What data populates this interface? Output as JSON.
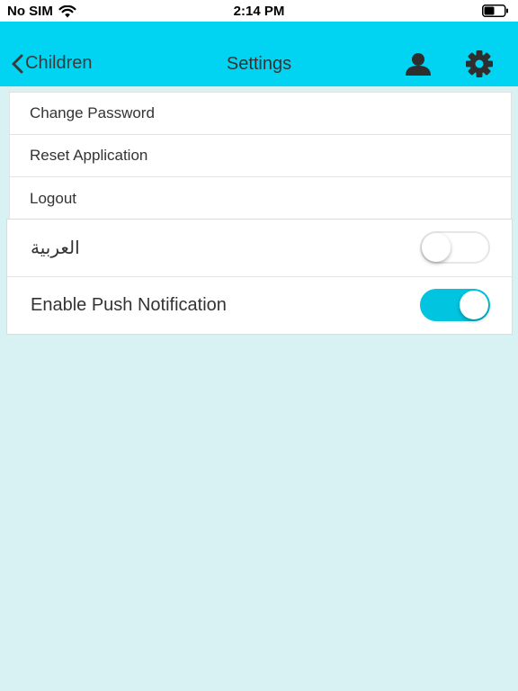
{
  "status_bar": {
    "carrier": "No SIM",
    "time": "2:14 PM",
    "wifi_icon": "wifi-icon",
    "battery_icon": "battery-icon"
  },
  "nav": {
    "back_label": "Children",
    "title": "Settings",
    "back_icon": "chevron-left-icon",
    "user_icon": "user-icon",
    "settings_icon": "gear-icon",
    "bar_color": "#00d4f2"
  },
  "menu": {
    "items": [
      {
        "label": "Change Password"
      },
      {
        "label": "Reset Application"
      },
      {
        "label": "Logout"
      }
    ]
  },
  "toggles": {
    "arabic": {
      "label": "العربية",
      "state": "off"
    },
    "push": {
      "label": "Enable Push Notification",
      "state": "on"
    }
  },
  "colors": {
    "background": "#d8f1f3",
    "toggle_on": "#00c4e0"
  }
}
